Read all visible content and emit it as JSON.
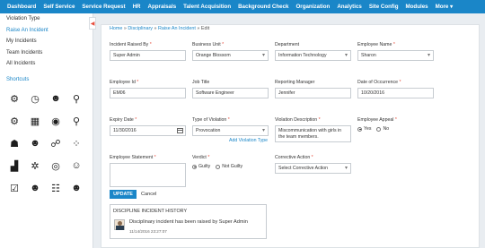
{
  "nav": [
    "Dashboard",
    "Self Service",
    "Service Request",
    "HR",
    "Appraisals",
    "Talent Acquisition",
    "Background Check",
    "Organization",
    "Analytics",
    "Site Config",
    "Modules",
    "More ▾"
  ],
  "sidebar": {
    "items": [
      "Violation Type",
      "Raise An Incident",
      "My Incidents",
      "Team Incidents",
      "All Incidents"
    ],
    "shortcuts": "Shortcuts",
    "icons": [
      "settings-cogs-icon",
      "clock-icon",
      "people-group-icon",
      "person-pin-icon",
      "money-cogs-icon",
      "buildings-icon",
      "coins-gear-icon",
      "location-pin-icon",
      "person-chart-icon",
      "person-money-icon",
      "person-network-icon",
      "people-grid-icon",
      "bar-chart-icon",
      "gear-ring-icon",
      "target-icon",
      "chat-users-icon",
      "checklist-icon",
      "person-gear-icon",
      "org-chart-icon",
      "people-badge-icon"
    ],
    "collapse": "◀"
  },
  "breadcrumb": {
    "home": "Home",
    "sep1": "»",
    "disciplinary": "Disciplinary",
    "sep2": "»",
    "raise": "Raise An Incident",
    "sep3": "»",
    "edit": "Edit"
  },
  "form": {
    "raised_by": {
      "label": "Incident Raised By",
      "value": "Super Admin"
    },
    "business_unit": {
      "label": "Business Unit",
      "value": "Orange Blossom"
    },
    "department": {
      "label": "Department",
      "value": "Information Technology"
    },
    "employee_name": {
      "label": "Employee Name",
      "value": "Sharon"
    },
    "employee_id": {
      "label": "Employee Id",
      "value": "EM06"
    },
    "job_title": {
      "label": "Job Title",
      "value": "Software Engineer"
    },
    "reporting_manager": {
      "label": "Reporting Manager",
      "value": "Jennifer"
    },
    "date_of_occurrence": {
      "label": "Date of Occurrence",
      "value": "10/20/2016"
    },
    "expiry_date": {
      "label": "Expiry Date",
      "value": "11/30/2016"
    },
    "violation_type": {
      "label": "Type of Violation",
      "value": "Provocation",
      "add_link": "Add Violation Type"
    },
    "violation_description": {
      "label": "Violation Description",
      "value": "Miscommunication with girls in the team members."
    },
    "employee_appeal": {
      "label": "Employee Appeal",
      "yes": "Yes",
      "no": "No",
      "selected": "Yes"
    },
    "employee_statement": {
      "label": "Employee Statement",
      "value": ""
    },
    "verdict": {
      "label": "Verdict",
      "guilty": "Guilty",
      "not_guilty": "Not Guilty",
      "selected": "Guilty"
    },
    "corrective_action": {
      "label": "Corrective Action",
      "value": "Select Corrective Action"
    },
    "required_mark": "*"
  },
  "actions": {
    "update": "UPDATE",
    "cancel": "Cancel"
  },
  "history": {
    "title": "DISCIPLINE INCIDENT HISTORY",
    "message": "Disciplinary incident has been raised by Super Admin",
    "timestamp": "11/14/2016 23:27:07"
  },
  "colors": {
    "accent": "#1a86c8",
    "required": "#e74c3c"
  }
}
